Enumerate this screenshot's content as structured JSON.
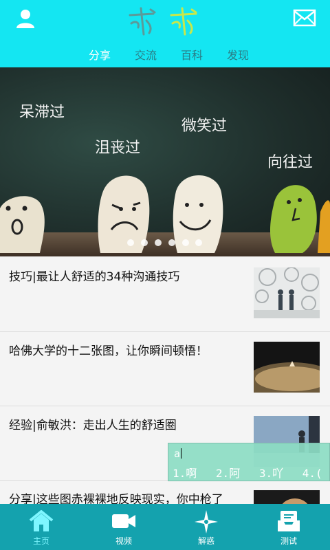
{
  "header": {
    "logo_text": "",
    "tabs": [
      {
        "label": "分享",
        "active": true
      },
      {
        "label": "交流",
        "active": false
      },
      {
        "label": "百科",
        "active": false
      },
      {
        "label": "发现",
        "active": false
      }
    ],
    "user_icon": "user-icon",
    "mail_icon": "mail-icon"
  },
  "banner": {
    "captions": [
      "呆滞过",
      "沮丧过",
      "微笑过",
      "向往过"
    ],
    "slide_count": 6,
    "active_slide": 2
  },
  "articles": [
    {
      "title": "技巧|最让人舒适的34种沟通技巧"
    },
    {
      "title": "哈佛大学的十二张图，让你瞬间顿悟！"
    },
    {
      "title": "经验|俞敏洪：走出人生的舒适圈"
    },
    {
      "title": "分享|这些图赤裸裸地反映现实，你中枪了"
    }
  ],
  "ime": {
    "input": "a",
    "candidates": [
      "1.啊",
      "2.阿",
      "3.吖",
      "4.("
    ]
  },
  "tabbar": {
    "items": [
      {
        "label": "主页",
        "icon": "home-icon",
        "active": true
      },
      {
        "label": "视频",
        "icon": "video-camera-icon",
        "active": false
      },
      {
        "label": "解惑",
        "icon": "compass-star-icon",
        "active": false
      },
      {
        "label": "测试",
        "icon": "inbox-test-icon",
        "active": false
      }
    ]
  },
  "colors": {
    "header_bg": "#14e6f2",
    "tabbar_bg": "#14a2ae",
    "active_tab": "#ffffff"
  }
}
